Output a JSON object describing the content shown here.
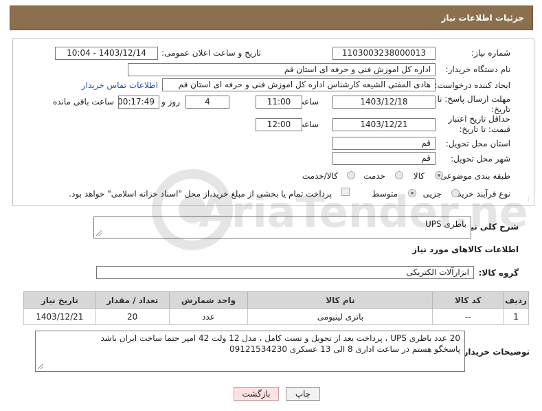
{
  "header": {
    "title": "جزئیات اطلاعات نیاز"
  },
  "form": {
    "need_number": {
      "label": "شماره نیاز:",
      "value": "1103003238000013"
    },
    "announce_datetime": {
      "label": "تاریخ و ساعت اعلان عمومی:",
      "value": "1403/12/14 - 10:04"
    },
    "buyer_org": {
      "label": "نام دستگاه خریدار:",
      "value": "اداره کل اموزش فنی و حرفه ای استان قم"
    },
    "requester": {
      "label": "ایجاد کننده درخواست:",
      "value": "هادی المفتی الشیعه کارشناس اداره کل اموزش فنی و حرفه ای استان قم",
      "contact_link": "اطلاعات تماس خریدار"
    },
    "reply_deadline": {
      "label": "مهلت ارسال پاسخ: تا تاریخ:",
      "date": "1403/12/18",
      "time_label": "ساعت",
      "time": "11:00",
      "days": "4",
      "days_label": "روز و",
      "remaining": "00:17:49",
      "remaining_label": "ساعت باقی مانده"
    },
    "price_validity": {
      "label": "حداقل تاریخ اعتبار قیمت: تا تاریخ:",
      "date": "1403/12/21",
      "time_label": "ساعت",
      "time": "12:00"
    },
    "delivery_province": {
      "label": "استان محل تحویل:",
      "value": "قم"
    },
    "delivery_city": {
      "label": "شهر محل تحویل:",
      "value": "قم"
    },
    "subject_category": {
      "label": "طبقه بندی موضوعی:",
      "options": [
        "کالا",
        "خدمت",
        "کالا/خدمت"
      ],
      "selected": "کالا"
    },
    "purchase_process": {
      "label": "نوع فرآیند خرید :",
      "options": [
        "جزیی",
        "متوسط"
      ],
      "selected": "متوسط",
      "payment_note": "پرداخت تمام یا بخشی از مبلغ خرید،از محل \"اسناد خزانه اسلامی\" خواهد بود."
    }
  },
  "description": {
    "label": "شرح کلی نیاز:",
    "value": "باطری UPS"
  },
  "goods_info": {
    "title": "اطلاعات کالاهای مورد نیاز"
  },
  "goods_group": {
    "label": "گروه کالا:",
    "value": "ابزارآلات الکتریکی"
  },
  "table": {
    "headers": [
      "ردیف",
      "کد کالا",
      "نام کالا",
      "واحد شمارش",
      "تعداد / مقدار",
      "تاریخ نیاز"
    ],
    "rows": [
      [
        "1",
        "--",
        "باتری لیتیومی",
        "عدد",
        "20",
        "1403/12/21"
      ]
    ]
  },
  "buyer_notes": {
    "label": "توضیحات خریدار:",
    "lines": [
      "20 عدد باطری UPS ، پرداخت بعد از تحویل و تست کامل ، مدل 12 ولت 42 امپر حتما ساخت ایران باشد",
      "پاسخگو هستم در ساعت اداری 8 الی 13 عسکری 09121534230"
    ]
  },
  "buttons": {
    "print": "چاپ",
    "back": "بازگشت"
  },
  "watermark": {
    "text": "AriaTender.neT"
  }
}
